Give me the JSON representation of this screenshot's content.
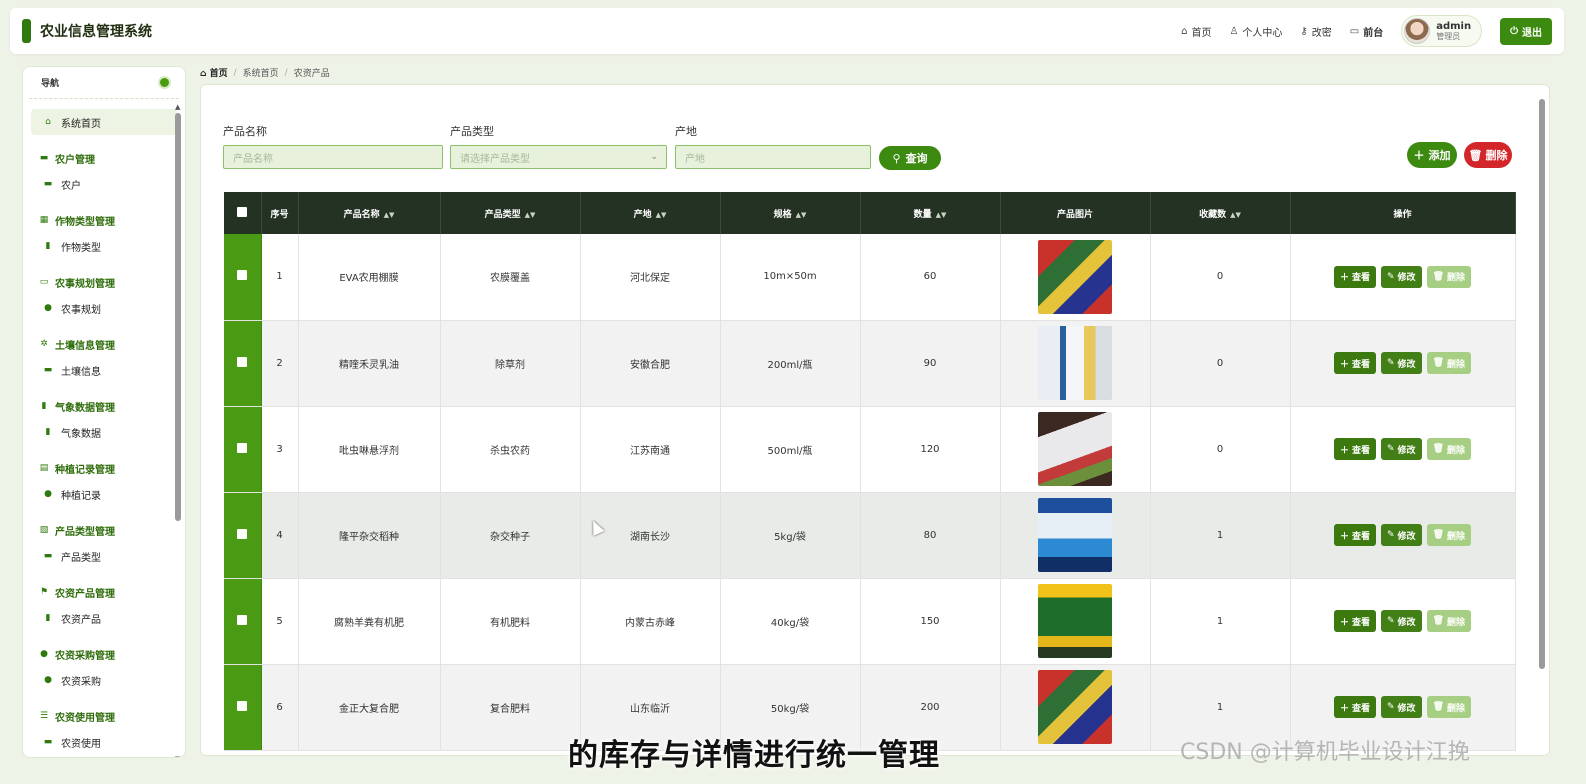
{
  "header": {
    "app_title": "农业信息管理系统",
    "links": {
      "home": "首页",
      "profile": "个人中心",
      "password": "改密",
      "frontend": "前台"
    },
    "user": {
      "name": "admin",
      "role": "管理员"
    },
    "logout": "退出"
  },
  "sidebar": {
    "nav_title": "导航",
    "home_item": "系统首页",
    "groups": [
      {
        "title": "农户管理",
        "item": "农户"
      },
      {
        "title": "作物类型管理",
        "item": "作物类型"
      },
      {
        "title": "农事规划管理",
        "item": "农事规划"
      },
      {
        "title": "土壤信息管理",
        "item": "土壤信息"
      },
      {
        "title": "气象数据管理",
        "item": "气象数据"
      },
      {
        "title": "种植记录管理",
        "item": "种植记录"
      },
      {
        "title": "产品类型管理",
        "item": "产品类型"
      },
      {
        "title": "农资产品管理",
        "item": "农资产品"
      },
      {
        "title": "农资采购管理",
        "item": "农资采购"
      },
      {
        "title": "农资使用管理",
        "item": "农资使用"
      }
    ]
  },
  "breadcrumb": {
    "home": "首页",
    "level1": "系统首页",
    "level2": "农资产品"
  },
  "filters": {
    "name_label": "产品名称",
    "name_placeholder": "产品名称",
    "type_label": "产品类型",
    "type_placeholder": "请选择产品类型",
    "origin_label": "产地",
    "origin_placeholder": "产地",
    "query": "查询",
    "add": "添加",
    "delete": "删除"
  },
  "table": {
    "headers": [
      "序号",
      "产品名称",
      "产品类型",
      "产地",
      "规格",
      "数量",
      "产品图片",
      "收藏数",
      "操作"
    ],
    "rows": [
      {
        "no": "1",
        "name": "EVA农用棚膜",
        "type": "农膜覆盖",
        "origin": "河北保定",
        "spec": "10m×50m",
        "qty": "60",
        "fav": "0"
      },
      {
        "no": "2",
        "name": "精喹禾灵乳油",
        "type": "除草剂",
        "origin": "安徽合肥",
        "spec": "200ml/瓶",
        "qty": "90",
        "fav": "0"
      },
      {
        "no": "3",
        "name": "吡虫啉悬浮剂",
        "type": "杀虫农药",
        "origin": "江苏南通",
        "spec": "500ml/瓶",
        "qty": "120",
        "fav": "0"
      },
      {
        "no": "4",
        "name": "隆平杂交稻种",
        "type": "杂交种子",
        "origin": "湖南长沙",
        "spec": "5kg/袋",
        "qty": "80",
        "fav": "1"
      },
      {
        "no": "5",
        "name": "腐熟羊粪有机肥",
        "type": "有机肥料",
        "origin": "内蒙古赤峰",
        "spec": "40kg/袋",
        "qty": "150",
        "fav": "1"
      },
      {
        "no": "6",
        "name": "金正大复合肥",
        "type": "复合肥料",
        "origin": "山东临沂",
        "spec": "50kg/袋",
        "qty": "200",
        "fav": "1"
      }
    ],
    "actions": {
      "view": "查看",
      "edit": "修改",
      "delete": "删除"
    }
  },
  "caption": "的库存与详情进行统一管理",
  "watermark": "CSDN @计算机毕业设计江挽",
  "colors": {
    "primary": "#3c8a10",
    "danger": "#d3262b",
    "header_dark": "#243224"
  }
}
